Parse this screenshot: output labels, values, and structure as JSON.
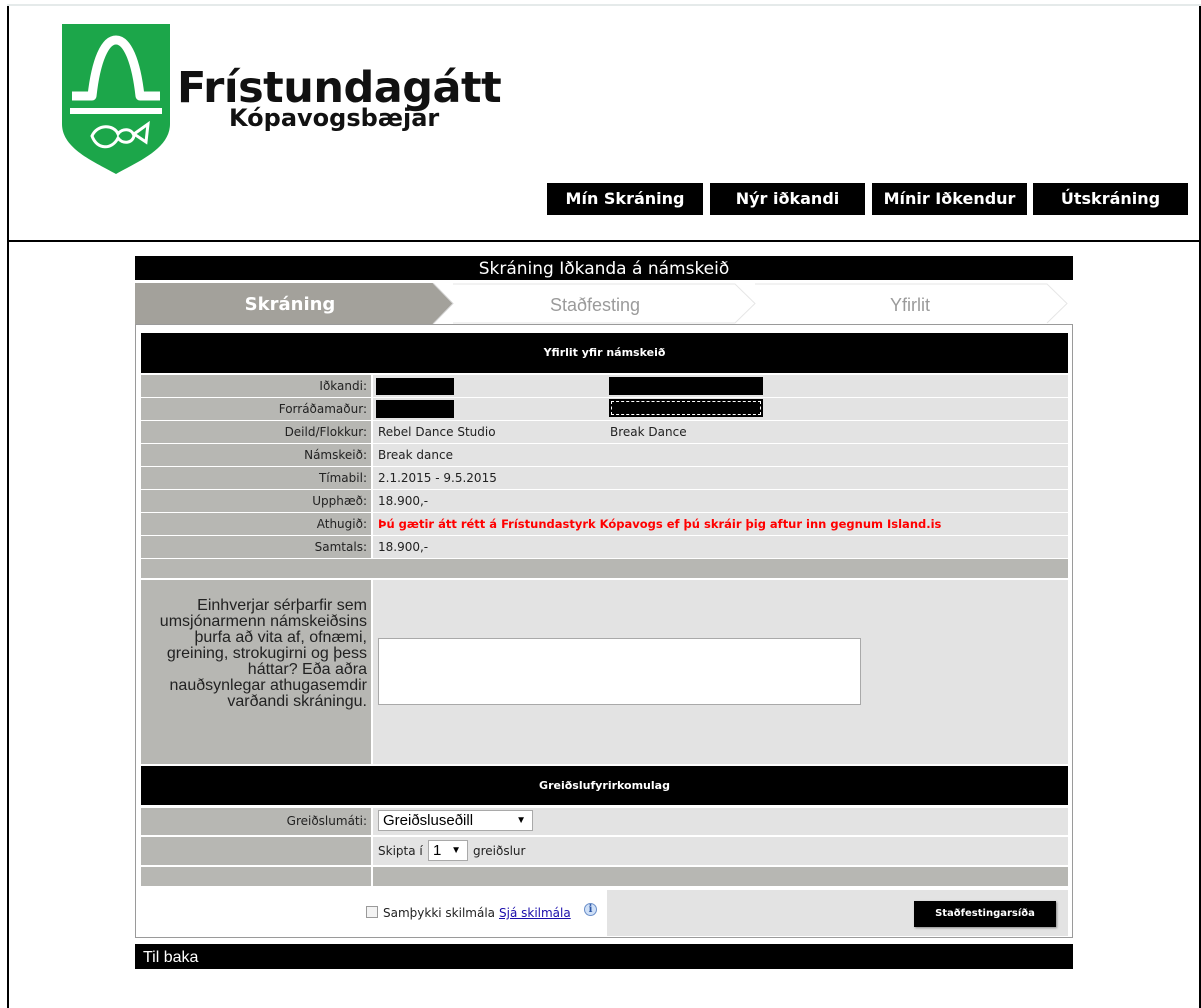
{
  "brand": {
    "title": "Frístundagátt",
    "subtitle": "Kópavogsbæjar"
  },
  "nav": {
    "my_registration": "Mín Skráning",
    "new_participant": "Nýr iðkandi",
    "my_participants": "Mínir Iðkendur",
    "logout": "Útskráning"
  },
  "page_title": "Skráning Iðkanda á námskeið",
  "steps": {
    "step1": "Skráning",
    "step2": "Staðfesting",
    "step3": "Yfirlit",
    "active": 1
  },
  "overview": {
    "header": "Yfirlit yfir námskeið",
    "participant_label": "Iðkandi:",
    "guardian_label": "Forráðamaður:",
    "department_label": "Deild/Flokkur:",
    "department_value": "Rebel Dance Studio",
    "department_value2": "Break Dance",
    "course_label": "Námskeið:",
    "course_value": "Break dance",
    "period_label": "Tímabil:",
    "period_value": "2.1.2015 - 9.5.2015",
    "amount_label": "Upphæð:",
    "amount_value": "18.900,-",
    "note_label": "Athugið:",
    "note_value": "Þú gætir átt rétt á Frístundastyrk Kópavogs ef þú skráir þig aftur inn gegnum Island.is",
    "total_label": "Samtals:",
    "total_value": "18.900,-"
  },
  "special_needs": {
    "label": "Einhverjar sérþarfir sem umsjónarmenn námskeiðsins þurfa að vita af, ofnæmi, greining, strokugirni og þess háttar? Eða aðra nauðsynlegar athugasemdir varðandi skráningu.",
    "value": ""
  },
  "payment": {
    "header": "Greiðslufyrirkomulag",
    "method_label": "Greiðslumáti:",
    "method_value": "Greiðsluseðill",
    "split_prefix": "Skipta í",
    "split_value": "1",
    "split_suffix": "greiðslur"
  },
  "terms": {
    "accept_label": "Samþykki skilmála",
    "link": "Sjá skilmála"
  },
  "confirm_button": "Staðfestingarsíða",
  "back": "Til baka",
  "colors": {
    "brand_green": "#1ca64a",
    "label_grey": "#b7b7b3",
    "value_grey": "#e3e3e3",
    "warning_red": "#ff0000"
  }
}
